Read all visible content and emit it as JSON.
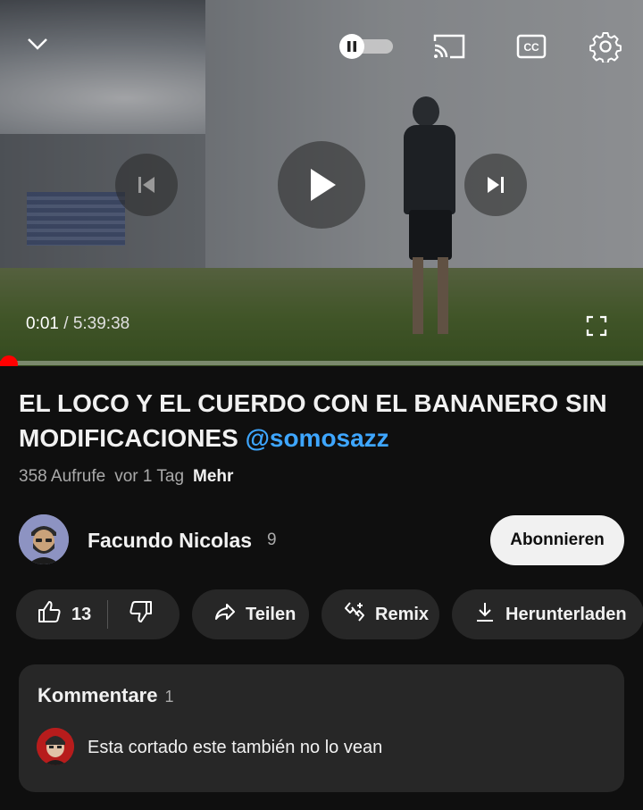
{
  "player": {
    "current_time": "0:01",
    "separator": " / ",
    "duration": "5:39:38",
    "progress_fraction": 0.0001,
    "controls": [
      "chevron-down-icon",
      "autoplay-toggle",
      "cast-icon",
      "captions-icon",
      "settings-icon",
      "previous-icon",
      "play-icon",
      "next-icon",
      "fullscreen-icon"
    ]
  },
  "video": {
    "title": "EL LOCO Y EL CUERDO CON EL BANANERO SIN MODIFICACIONES",
    "mention": "@somosazz",
    "views": "358 Aufrufe",
    "age": "vor 1 Tag",
    "more": "Mehr"
  },
  "channel": {
    "name": "Facundo Nicolas",
    "subscribers": "9",
    "subscribe_label": "Abonnieren"
  },
  "actions": {
    "likes": "13",
    "share": "Teilen",
    "remix": "Remix",
    "download": "Herunterladen"
  },
  "comments": {
    "heading": "Kommentare",
    "count": "1",
    "top_comment": "Esta cortado este también no lo vean"
  },
  "colors": {
    "background": "#0f0f0f",
    "surface": "#272727",
    "accent_red": "#ff0000",
    "mention_blue": "#3ea6ff"
  }
}
